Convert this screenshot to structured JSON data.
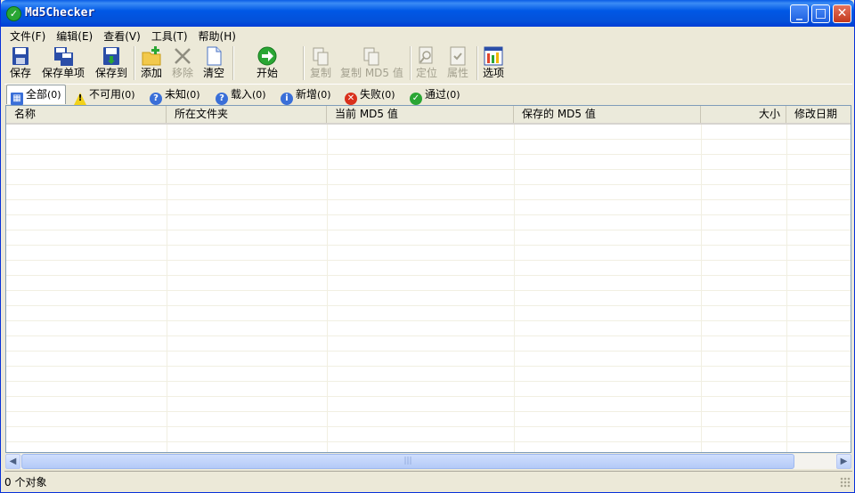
{
  "window": {
    "title": "Md5Checker"
  },
  "menu": [
    "文件(F)",
    "编辑(E)",
    "查看(V)",
    "工具(T)",
    "帮助(H)"
  ],
  "toolbar": {
    "save": "保存",
    "save_single": "保存单项",
    "save_to": "保存到",
    "add": "添加",
    "remove": "移除",
    "clear": "清空",
    "start": "开始",
    "copy": "复制",
    "copy_md5": "复制 MD5 值",
    "locate": "定位",
    "properties": "属性",
    "options": "选项"
  },
  "tabs": [
    {
      "label": "全部",
      "count": "(0)"
    },
    {
      "label": "不可用",
      "count": "(0)"
    },
    {
      "label": "未知",
      "count": "(0)"
    },
    {
      "label": "载入",
      "count": "(0)"
    },
    {
      "label": "新增",
      "count": "(0)"
    },
    {
      "label": "失败",
      "count": "(0)"
    },
    {
      "label": "通过",
      "count": "(0)"
    }
  ],
  "columns": [
    "名称",
    "所在文件夹",
    "当前 MD5 值",
    "保存的 MD5 值",
    "大小",
    "修改日期"
  ],
  "statusbar": {
    "text": "0 个对象"
  },
  "colors": {
    "titlebar": "#0058e6",
    "face": "#ece9d8",
    "accent_green": "#2aa634"
  }
}
